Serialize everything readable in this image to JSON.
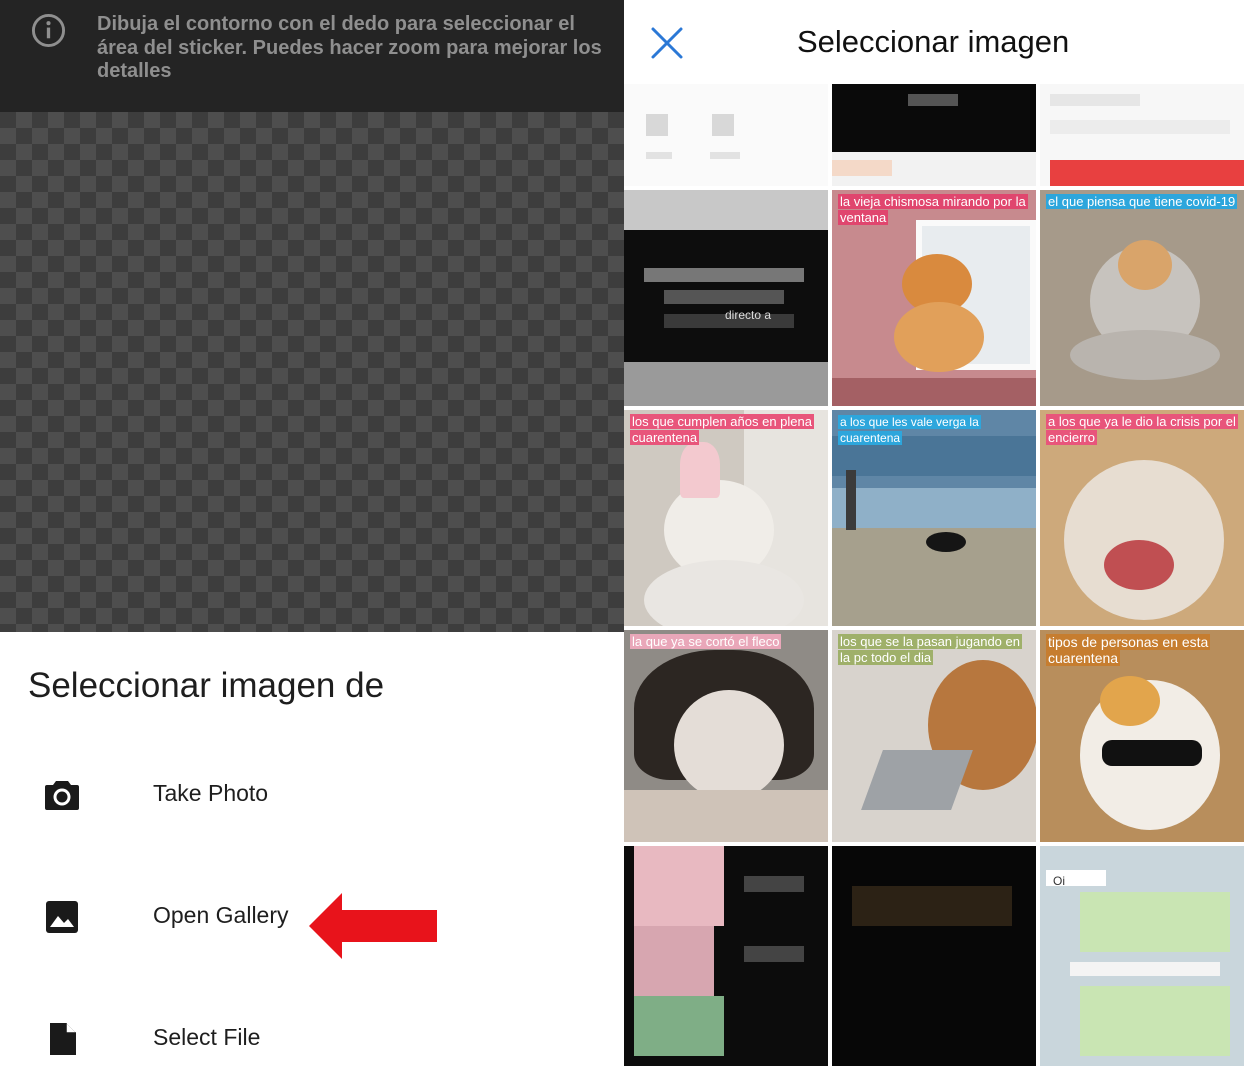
{
  "editor": {
    "hint": "Dibuja el contorno con el dedo para seleccionar el área del sticker. Puedes hacer zoom para mejorar los detalles",
    "icons": {
      "info": "info-icon"
    }
  },
  "source_sheet": {
    "title": "Seleccionar imagen de",
    "options": [
      {
        "label": "Take Photo",
        "icon": "camera-icon"
      },
      {
        "label": "Open Gallery",
        "icon": "image-icon"
      },
      {
        "label": "Select File",
        "icon": "file-icon"
      }
    ],
    "annotation_color": "#e8131b"
  },
  "picker": {
    "title": "Seleccionar imagen",
    "close_icon": "close-icon",
    "accent": "#2b78d6",
    "tiles": [
      {
        "caption": ""
      },
      {
        "caption": ""
      },
      {
        "caption": ""
      },
      {
        "caption": "",
        "partial_text": "directo a"
      },
      {
        "caption": "la vieja chismosa mirando por la ventana"
      },
      {
        "caption": "el que piensa que tiene covid-19"
      },
      {
        "caption": "los que cumplen años en plena cuarentena"
      },
      {
        "caption": "a los que les vale verga la cuarentena"
      },
      {
        "caption": "a los que ya le dio la crisis por el encierro"
      },
      {
        "caption": "la que ya se cortó el fleco"
      },
      {
        "caption": "los que se la pasan jugando en la pc todo el dia"
      },
      {
        "caption": "tipos de personas en esta cuarentena"
      },
      {
        "caption": ""
      },
      {
        "caption": ""
      },
      {
        "caption": "",
        "partial_text": "Oi"
      }
    ]
  }
}
